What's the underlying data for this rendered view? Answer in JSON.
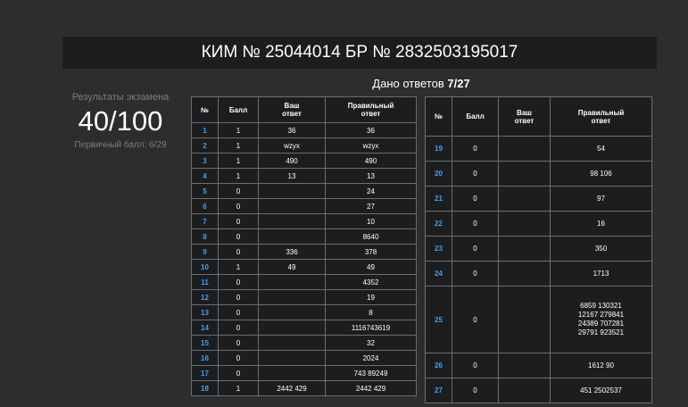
{
  "header": {
    "title": "КИМ № 25044014 БР № 2832503195017"
  },
  "answers": {
    "label": "Дано ответов",
    "value": "7/27"
  },
  "results": {
    "caption": "Результаты экзамена",
    "score": "40/100",
    "primary": "Первичный балл: 6/29"
  },
  "table_headers": {
    "num": "№",
    "score": "Балл",
    "yours_1": "Ваш",
    "yours_2": "ответ",
    "correct_1": "Правильный",
    "correct_2": "ответ"
  },
  "rows_left": [
    {
      "n": "1",
      "score": "1",
      "yours": "36",
      "correct": "36"
    },
    {
      "n": "2",
      "score": "1",
      "yours": "wzyx",
      "correct": "wzyx"
    },
    {
      "n": "3",
      "score": "1",
      "yours": "490",
      "correct": "490"
    },
    {
      "n": "4",
      "score": "1",
      "yours": "13",
      "correct": "13"
    },
    {
      "n": "5",
      "score": "0",
      "yours": "",
      "correct": "24"
    },
    {
      "n": "6",
      "score": "0",
      "yours": "",
      "correct": "27"
    },
    {
      "n": "7",
      "score": "0",
      "yours": "",
      "correct": "10"
    },
    {
      "n": "8",
      "score": "0",
      "yours": "",
      "correct": "8640"
    },
    {
      "n": "9",
      "score": "0",
      "yours": "336",
      "correct": "378"
    },
    {
      "n": "10",
      "score": "1",
      "yours": "49",
      "correct": "49"
    },
    {
      "n": "11",
      "score": "0",
      "yours": "",
      "correct": "4352"
    },
    {
      "n": "12",
      "score": "0",
      "yours": "",
      "correct": "19"
    },
    {
      "n": "13",
      "score": "0",
      "yours": "",
      "correct": "8"
    },
    {
      "n": "14",
      "score": "0",
      "yours": "",
      "correct": "1116743619"
    },
    {
      "n": "15",
      "score": "0",
      "yours": "",
      "correct": "32"
    },
    {
      "n": "16",
      "score": "0",
      "yours": "",
      "correct": "2024"
    },
    {
      "n": "17",
      "score": "0",
      "yours": "",
      "correct": "743 89249"
    },
    {
      "n": "18",
      "score": "1",
      "yours": "2442 429",
      "correct": "2442 429"
    }
  ],
  "rows_right": [
    {
      "n": "19",
      "score": "0",
      "yours": "",
      "correct": "54"
    },
    {
      "n": "20",
      "score": "0",
      "yours": "",
      "correct": "98 106"
    },
    {
      "n": "21",
      "score": "0",
      "yours": "",
      "correct": "97"
    },
    {
      "n": "22",
      "score": "0",
      "yours": "",
      "correct": "16"
    },
    {
      "n": "23",
      "score": "0",
      "yours": "",
      "correct": "350"
    },
    {
      "n": "24",
      "score": "0",
      "yours": "",
      "correct": "1713"
    },
    {
      "n": "25",
      "score": "0",
      "yours": "",
      "correct_lines": [
        "6859 130321",
        "12167 279841",
        "24389 707281",
        "29791 923521"
      ]
    },
    {
      "n": "26",
      "score": "0",
      "yours": "",
      "correct": "1612 90"
    },
    {
      "n": "27",
      "score": "0",
      "yours": "",
      "correct": "451 2502537"
    }
  ]
}
